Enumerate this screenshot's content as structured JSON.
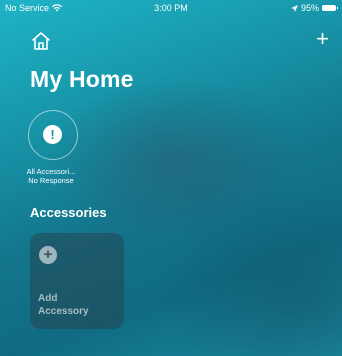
{
  "status_bar": {
    "carrier": "No Service",
    "time": "3:00 PM",
    "battery": "95%"
  },
  "header": {
    "title": "My Home"
  },
  "status_tile": {
    "glyph": "!",
    "caption_line1": "All Accessori...",
    "caption_line2": "No Response"
  },
  "accessories": {
    "section_title": "Accessories",
    "add_label_line1": "Add",
    "add_label_line2": "Accessory"
  }
}
